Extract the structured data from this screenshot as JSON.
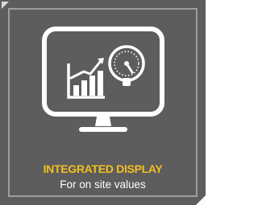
{
  "tile": {
    "title": "INTEGRATED DISPLAY",
    "subtitle": "For on site values",
    "icon": "monitor-with-chart-and-gauge-icon",
    "colors": {
      "background": "#5d5d5d",
      "title": "#f3bf21",
      "subtitle": "#ffffff",
      "icon": "#ffffff",
      "frame": "#9d9d9d"
    }
  }
}
